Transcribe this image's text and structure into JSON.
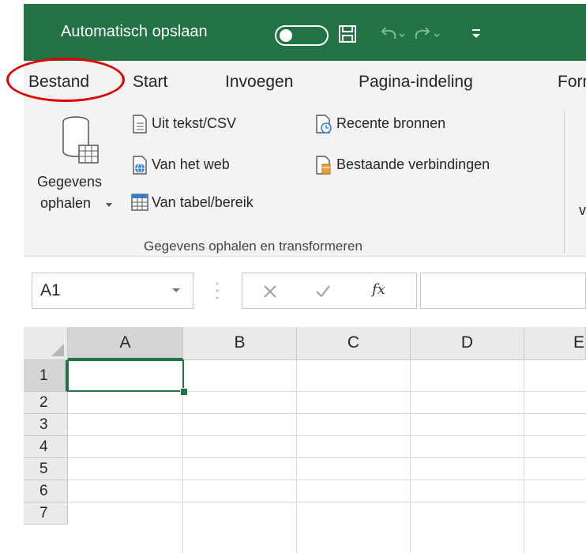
{
  "title_bar": {
    "autosave_label": "Automatisch opslaan",
    "autosave_state": "off",
    "color": "#217346"
  },
  "tabs": [
    {
      "label": "Bestand"
    },
    {
      "label": "Start"
    },
    {
      "label": "Invoegen"
    },
    {
      "label": "Pagina-indeling"
    },
    {
      "label": "Form"
    }
  ],
  "ribbon": {
    "get_data_line1": "Gegevens",
    "get_data_line2": "ophalen",
    "items_left": [
      "Uit tekst/CSV",
      "Van het web",
      "Van tabel/bereik"
    ],
    "items_right": [
      "Recente bronnen",
      "Bestaande verbindingen"
    ],
    "group_label": "Gegevens ophalen en transformeren",
    "cutoff_char": "v"
  },
  "formula_bar": {
    "name_box": "A1",
    "fx": "fx"
  },
  "grid": {
    "columns": [
      "A",
      "B",
      "C",
      "D",
      "E"
    ],
    "rows": [
      "1",
      "2",
      "3",
      "4",
      "5",
      "6",
      "7"
    ],
    "active_cell": "A1"
  },
  "annotation": {
    "highlight": "Bestand",
    "color": "#e00000"
  }
}
